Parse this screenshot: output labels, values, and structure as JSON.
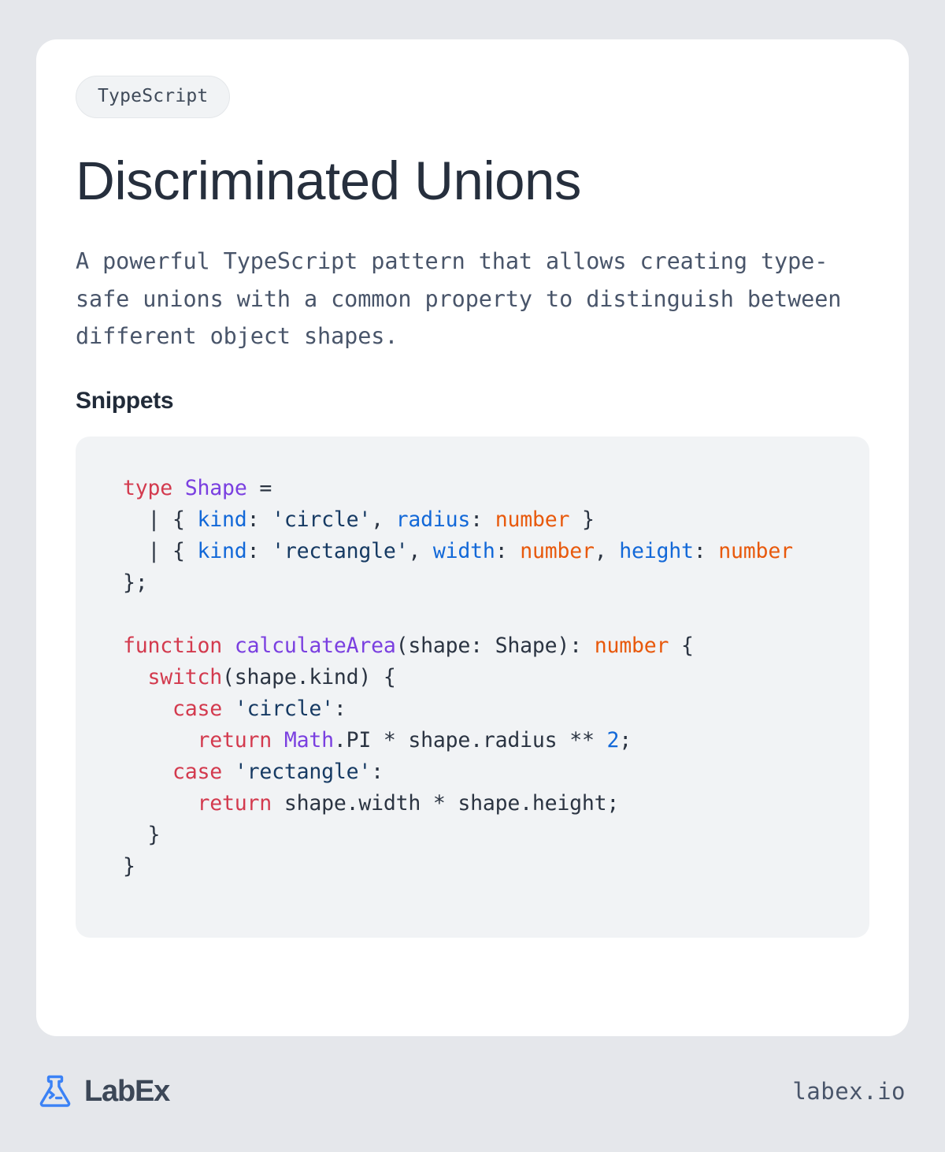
{
  "page": {
    "background_color": "#e5e7eb",
    "card_background": "#ffffff"
  },
  "badge": {
    "label": "TypeScript",
    "background_color": "#f1f3f5",
    "text_color": "#3f4a59"
  },
  "header": {
    "title": "Discriminated Unions",
    "title_color": "#262f3d",
    "description": "A powerful TypeScript pattern that allows creating type-safe unions with a common property to distinguish between different object shapes."
  },
  "snippets": {
    "heading": "Snippets",
    "language": "typescript",
    "code_background": "#f1f3f5",
    "code_text": "type Shape =\n  | { kind: 'circle', radius: number }\n  | { kind: 'rectangle', width: number, height: number\n};\n\nfunction calculateArea(shape: Shape): number {\n  switch(shape.kind) {\n    case 'circle':\n      return Math.PI * shape.radius ** 2;\n    case 'rectangle':\n      return shape.width * shape.height;\n  }\n}",
    "lines": [
      "type Shape =",
      "  | { kind: 'circle', radius: number }",
      "  | { kind: 'rectangle', width: number, height: number",
      "};",
      "",
      "function calculateArea(shape: Shape): number {",
      "  switch(shape.kind) {",
      "    case 'circle':",
      "      return Math.PI * shape.radius ** 2;",
      "    case 'rectangle':",
      "      return shape.width * shape.height;",
      "  }",
      "}"
    ],
    "syntax_colors": {
      "keyword": "#d33a4e",
      "type": "#7a3fe0",
      "property": "#1268d8",
      "builtin_type": "#e8590c",
      "string": "#163a63",
      "number": "#1268d8",
      "plain": "#2b3442"
    }
  },
  "footer": {
    "brand_name": "LabEx",
    "brand_icon": "flask-terminal-icon",
    "brand_icon_color": "#3b82f6",
    "site_url": "labex.io"
  }
}
